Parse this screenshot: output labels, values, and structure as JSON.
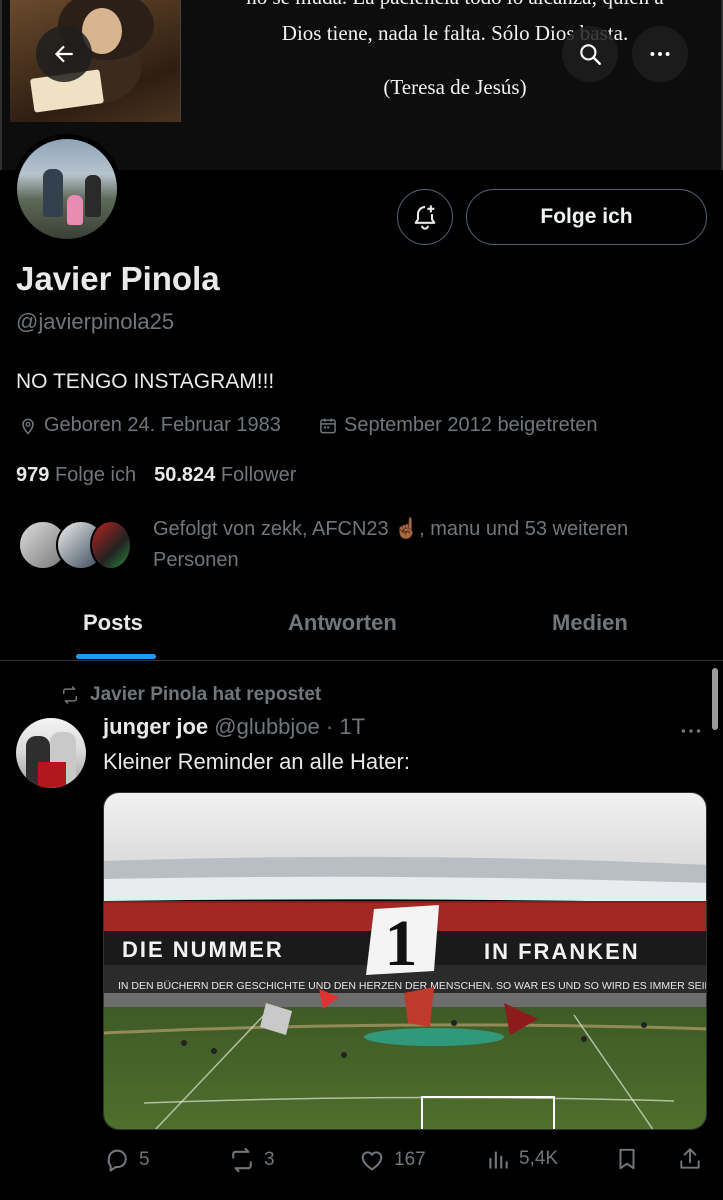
{
  "banner": {
    "quote_line0": "no se muda. La paciencia todo lo alcanza; quien a",
    "quote_line1": "Dios tiene, nada le falta. Sólo Dios basta.",
    "quote_author": "(Teresa de Jesús)"
  },
  "profile": {
    "display_name": "Javier Pinola",
    "handle": "@javierpinola25",
    "bio": "NO TENGO INSTAGRAM!!!",
    "birth": "Geboren 24. Februar 1983",
    "joined": "September 2012 beigetreten",
    "following_count": "979",
    "following_label": "Folge ich",
    "followers_count": "50.824",
    "followers_label": "Follower",
    "follow_button": "Folge ich",
    "followed_by_text": "Gefolgt von zekk, AFCN23 ☝🏾, manu und 53 weiteren Personen"
  },
  "tabs": [
    {
      "label": "Posts",
      "active": true
    },
    {
      "label": "Antworten",
      "active": false
    },
    {
      "label": "Medien",
      "active": false
    }
  ],
  "post": {
    "repost_label": "Javier Pinola hat repostet",
    "author_name": "junger joe",
    "author_handle": "@glubbjoe",
    "time": "· 1T",
    "text": "Kleiner Reminder an alle Hater:",
    "image_text_1": "DIE NUMMER",
    "image_text_2": "IN FRANKEN",
    "image_text_3": "IN DEN BÜCHERN DER GESCHICHTE UND DEN HERZEN DER MENSCHEN. SO WAR ES UND SO WIRD ES IMMER SEIN.",
    "image_big_number": "1",
    "replies": "5",
    "reposts": "3",
    "likes": "167",
    "views": "5,4K"
  },
  "colors": {
    "accent": "#1d9bf0",
    "muted": "#71767b",
    "text": "#e7e9ea",
    "background": "#000000"
  },
  "icons": [
    "back-arrow-icon",
    "search-icon",
    "more-icon",
    "bell-plus-icon",
    "location-icon",
    "calendar-icon",
    "repost-icon",
    "reply-icon",
    "like-icon",
    "views-icon",
    "bookmark-icon",
    "share-icon"
  ]
}
